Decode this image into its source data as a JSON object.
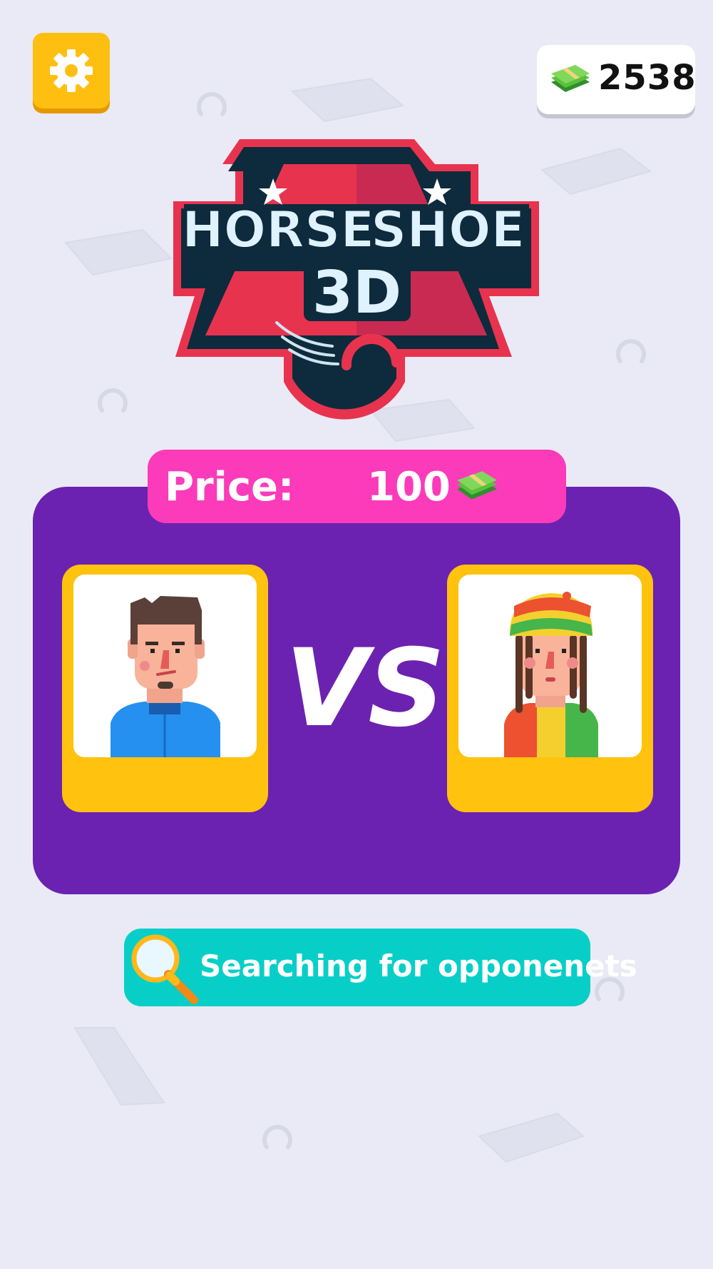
{
  "header": {
    "settings_icon": "gear-icon",
    "cash_icon": "money-stack-icon",
    "cash_amount": "2538"
  },
  "logo": {
    "line1_left": "HORSE",
    "line1_right": "SHOE",
    "line2": "3D"
  },
  "match": {
    "price_label": "Price:",
    "price_value": "100",
    "price_icon": "money-stack-icon",
    "vs_label": "VS",
    "player_one": {
      "avatar": "man-blue-jacket-avatar"
    },
    "player_two": {
      "avatar": "rasta-hat-avatar"
    }
  },
  "search": {
    "icon": "magnifier-icon",
    "label": "Searching for opponenets"
  },
  "colors": {
    "background": "#e9eaf5",
    "panel": "#6b22b0",
    "price_banner": "#fb3bb9",
    "card": "#ffc20e",
    "search_button": "#07cfc8",
    "settings_button": "#ffbf10"
  }
}
